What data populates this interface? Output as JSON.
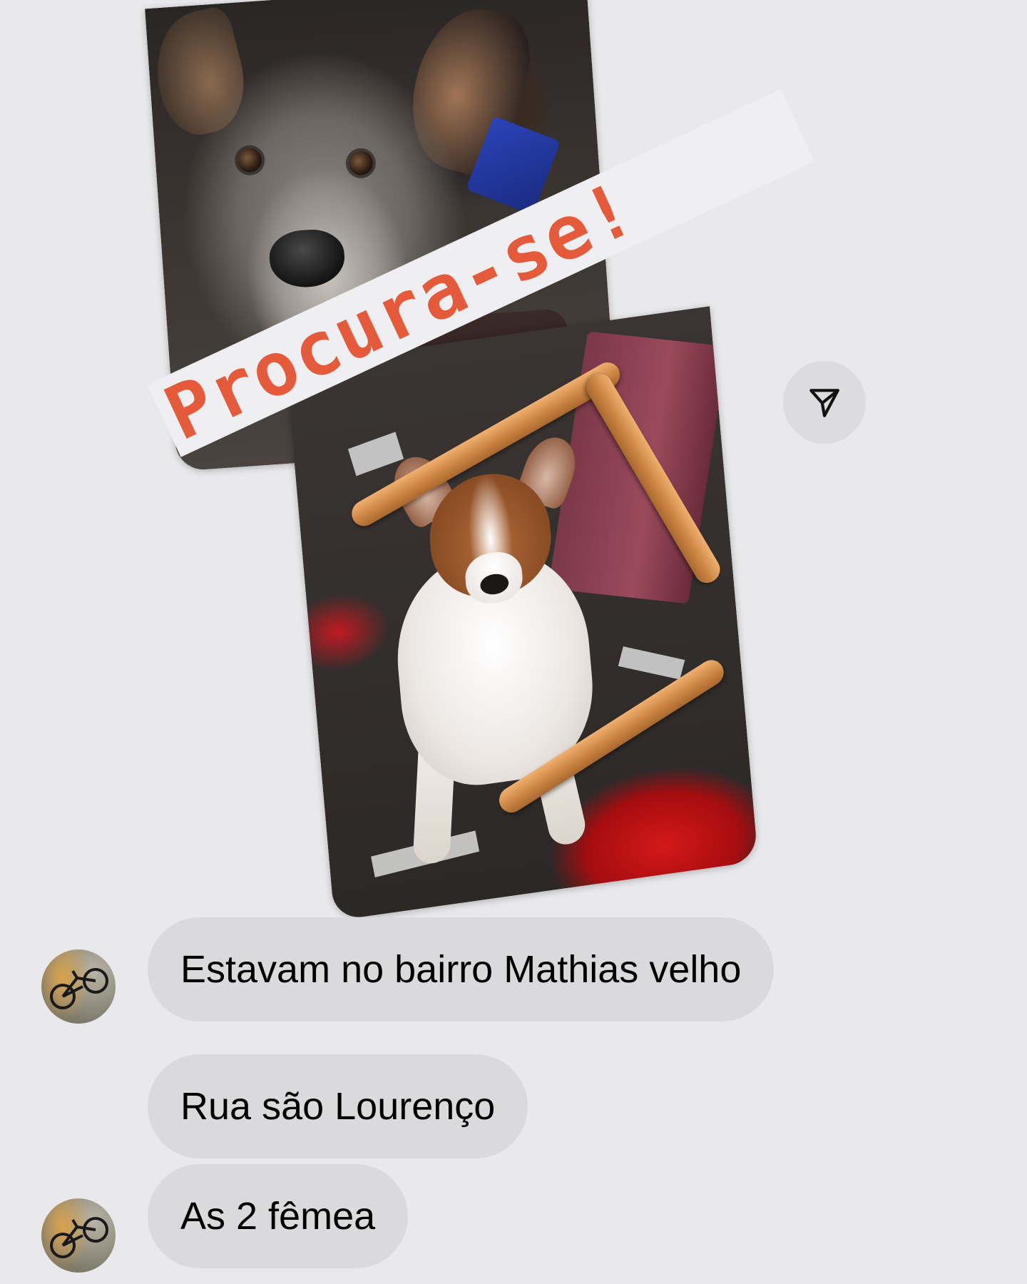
{
  "story": {
    "banner_text": "Procura-se!",
    "banner_color": "#e45a3a",
    "share_icon": "paper-plane-icon"
  },
  "messages": [
    {
      "text": "Estavam no bairro Mathias velho",
      "has_avatar": true
    },
    {
      "text": "Rua são Lourenço",
      "has_avatar": false
    },
    {
      "text": "As 2 fêmea",
      "has_avatar": true
    }
  ],
  "colors": {
    "background": "#e9e9eb",
    "bubble": "#dadadc"
  }
}
